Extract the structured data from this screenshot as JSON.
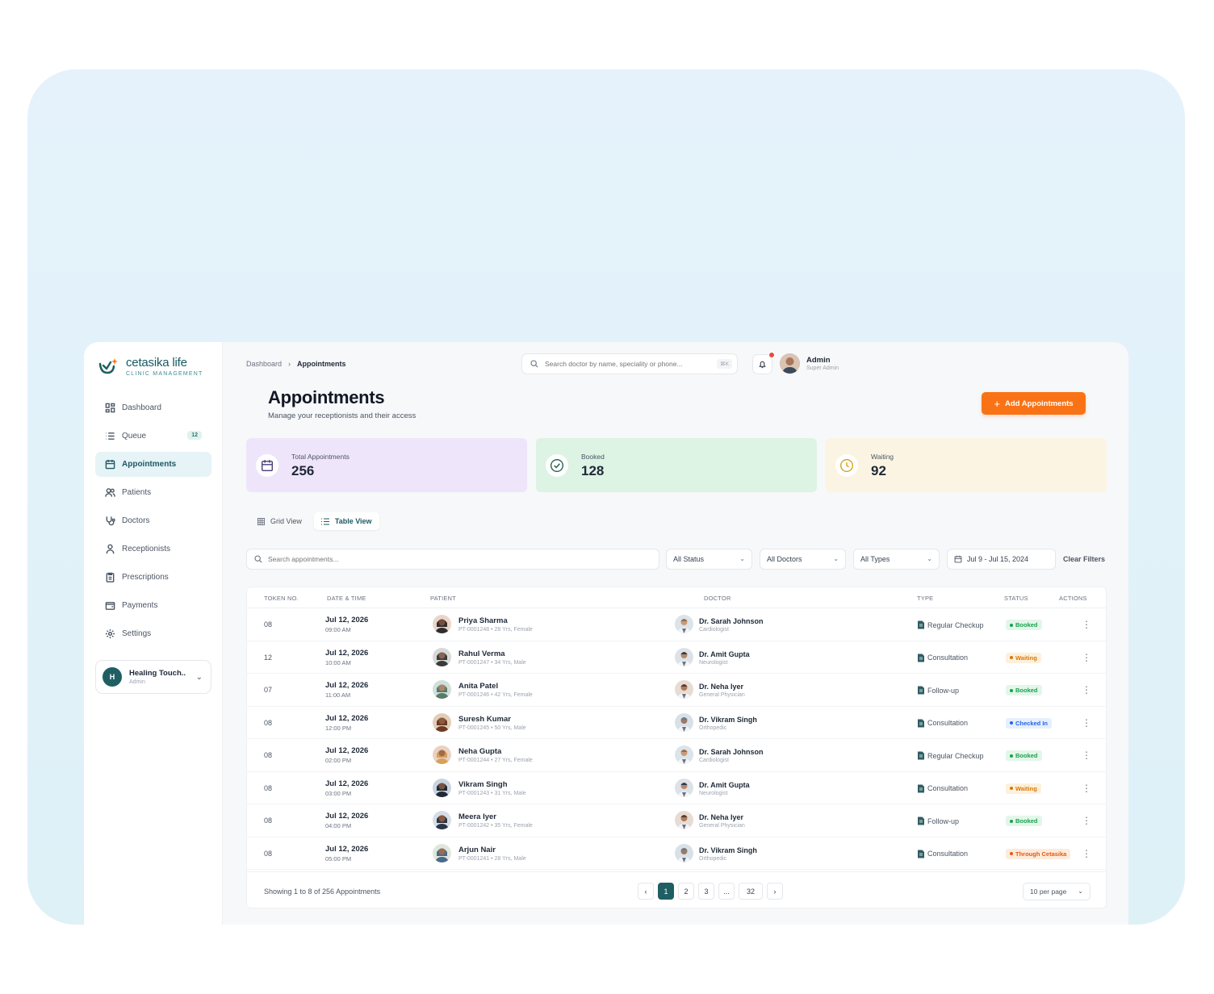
{
  "brand": {
    "name": "cetasika life",
    "tagline": "CLINIC MANAGEMENT"
  },
  "sidebar": {
    "items": [
      {
        "label": "Dashboard",
        "icon": "grid-icon"
      },
      {
        "label": "Queue",
        "icon": "list-icon",
        "badge": "12"
      },
      {
        "label": "Appointments",
        "icon": "calendar-icon",
        "active": true
      },
      {
        "label": "Patients",
        "icon": "users-icon"
      },
      {
        "label": "Doctors",
        "icon": "stethoscope-icon"
      },
      {
        "label": "Receptionists",
        "icon": "user-icon"
      },
      {
        "label": "Prescriptions",
        "icon": "clipboard-icon"
      },
      {
        "label": "Payments",
        "icon": "wallet-icon"
      },
      {
        "label": "Settings",
        "icon": "gear-icon"
      }
    ],
    "workspace": {
      "initial": "H",
      "name": "Healing Touch..",
      "role": "Admin"
    }
  },
  "header": {
    "breadcrumb": [
      "Dashboard",
      "Appointments"
    ],
    "search_placeholder": "Search doctor by name, speciality or phone...",
    "shortcut": "⌘K",
    "user": {
      "name": "Admin",
      "role": "Super Admin"
    }
  },
  "page": {
    "title": "Appointments",
    "subtitle": "Manage your receptionists and their access",
    "add_button": "Add Appointments"
  },
  "stats": [
    {
      "label": "Total Appointments",
      "value": "256",
      "color": "#efe5fb",
      "icon": "calendar-icon"
    },
    {
      "label": "Booked",
      "value": "128",
      "color": "#ddf3e4",
      "icon": "check-circle-icon"
    },
    {
      "label": "Waiting",
      "value": "92",
      "color": "#fcf4e3",
      "icon": "clock-icon"
    }
  ],
  "views": {
    "grid": "Grid View",
    "table": "Table View"
  },
  "filters": {
    "search_placeholder": "Search appointments...",
    "status": "All Status",
    "doctors": "All Doctors",
    "types": "All Types",
    "date_range": "Jul 9 - Jul 15, 2024",
    "clear": "Clear Filters"
  },
  "table": {
    "columns": [
      "TOKEN NO.",
      "DATE & TIME",
      "PATIENT",
      "DOCTOR",
      "TYPE",
      "STATUS",
      "ACTIONS"
    ],
    "rows": [
      {
        "token": "08",
        "date": "Jul 12, 2026",
        "time": "09:00 AM",
        "patient": "Priya Sharma",
        "pmeta": "PT-0001248 • 28 Yrs, Female",
        "doctor": "Dr. Sarah Johnson",
        "spec": "Cardiologist",
        "type": "Regular Checkup",
        "status": "Booked"
      },
      {
        "token": "12",
        "date": "Jul 12, 2026",
        "time": "10:00 AM",
        "patient": "Rahul Verma",
        "pmeta": "PT-0001247 • 34 Yrs, Male",
        "doctor": "Dr. Amit Gupta",
        "spec": "Neurologist",
        "type": "Consultation",
        "status": "Waiting"
      },
      {
        "token": "07",
        "date": "Jul 12, 2026",
        "time": "11:00 AM",
        "patient": "Anita Patel",
        "pmeta": "PT-0001246 • 42 Yrs, Female",
        "doctor": "Dr. Neha Iyer",
        "spec": "General Physician",
        "type": "Follow-up",
        "status": "Booked"
      },
      {
        "token": "08",
        "date": "Jul 12, 2026",
        "time": "12:00 PM",
        "patient": "Suresh Kumar",
        "pmeta": "PT-0001245 • 50 Yrs, Male",
        "doctor": "Dr. Vikram Singh",
        "spec": "Orthopedic",
        "type": "Consultation",
        "status": "Checked In"
      },
      {
        "token": "08",
        "date": "Jul 12, 2026",
        "time": "02:00 PM",
        "patient": "Neha Gupta",
        "pmeta": "PT-0001244 • 27 Yrs, Female",
        "doctor": "Dr. Sarah Johnson",
        "spec": "Cardiologist",
        "type": "Regular Checkup",
        "status": "Booked"
      },
      {
        "token": "08",
        "date": "Jul 12, 2026",
        "time": "03:00 PM",
        "patient": "Vikram Singh",
        "pmeta": "PT-0001243 • 31 Yrs, Male",
        "doctor": "Dr. Amit Gupta",
        "spec": "Neurologist",
        "type": "Consultation",
        "status": "Waiting"
      },
      {
        "token": "08",
        "date": "Jul 12, 2026",
        "time": "04:00 PM",
        "patient": "Meera Iyer",
        "pmeta": "PT-0001242 • 35 Yrs, Female",
        "doctor": "Dr. Neha Iyer",
        "spec": "General Physician",
        "type": "Follow-up",
        "status": "Booked"
      },
      {
        "token": "08",
        "date": "Jul 12, 2026",
        "time": "05:00 PM",
        "patient": "Arjun Nair",
        "pmeta": "PT-0001241 • 28 Yrs, Male",
        "doctor": "Dr. Vikram Singh",
        "spec": "Orthopedic",
        "type": "Consultation",
        "status": "Through Cetasika"
      }
    ]
  },
  "pagination": {
    "showing": "Showing 1 to 8 of 256 Appointments",
    "pages": [
      "1",
      "2",
      "3",
      "...",
      "32"
    ],
    "per_page": "10 per page"
  },
  "colors": {
    "brand": "#1f5f63",
    "accent": "#f97316",
    "booked": "#16a34a",
    "waiting": "#d97706",
    "checked_in": "#2563eb",
    "through": "#ea580c"
  }
}
